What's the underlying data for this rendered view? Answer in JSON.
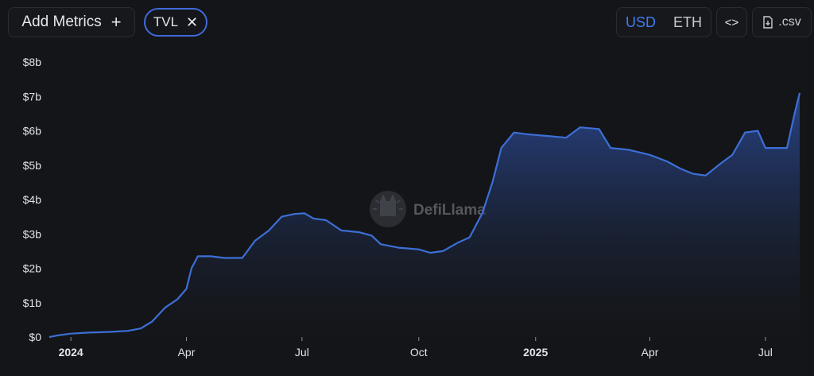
{
  "toolbar": {
    "add_metrics_label": "Add Metrics",
    "add_metrics_icon": "plus-icon",
    "metric_chip_label": "TVL",
    "metric_chip_icon": "close-icon",
    "currency_options": [
      "USD",
      "ETH"
    ],
    "currency_selected": "USD",
    "embed_icon": "code-icon",
    "csv_label": ".csv",
    "csv_icon": "download-file-icon"
  },
  "watermark": {
    "label": "DefiLlama",
    "icon": "llama-logo-icon"
  },
  "colors": {
    "line": "#3c6fd6",
    "area_top": "#2b4a96",
    "area_bottom": "#16181d",
    "background": "#141518",
    "accent": "#3f7cf2"
  },
  "chart_data": {
    "type": "area",
    "title": "",
    "xlabel": "",
    "ylabel": "",
    "ylim": [
      0,
      8
    ],
    "y_ticks": [
      {
        "value": 0,
        "label": "$0"
      },
      {
        "value": 1,
        "label": "$1b"
      },
      {
        "value": 2,
        "label": "$2b"
      },
      {
        "value": 3,
        "label": "$3b"
      },
      {
        "value": 4,
        "label": "$4b"
      },
      {
        "value": 5,
        "label": "$5b"
      },
      {
        "value": 6,
        "label": "$6b"
      },
      {
        "value": 7,
        "label": "$7b"
      },
      {
        "value": 8,
        "label": "$8b"
      }
    ],
    "xlim": [
      "2023-12-15",
      "2025-07-28"
    ],
    "x_ticks": [
      {
        "date": "2024-01-01",
        "label": "2024",
        "bold": true
      },
      {
        "date": "2024-04-01",
        "label": "Apr",
        "bold": false
      },
      {
        "date": "2024-07-01",
        "label": "Jul",
        "bold": false
      },
      {
        "date": "2024-10-01",
        "label": "Oct",
        "bold": false
      },
      {
        "date": "2025-01-01",
        "label": "2025",
        "bold": true
      },
      {
        "date": "2025-04-01",
        "label": "Apr",
        "bold": false
      },
      {
        "date": "2025-07-01",
        "label": "Jul",
        "bold": false
      }
    ],
    "grid": false,
    "series": [
      {
        "unit": "$b",
        "points": [
          [
            "2023-12-15",
            0.0
          ],
          [
            "2023-12-22",
            0.05
          ],
          [
            "2024-01-01",
            0.1
          ],
          [
            "2024-01-15",
            0.13
          ],
          [
            "2024-02-01",
            0.15
          ],
          [
            "2024-02-15",
            0.18
          ],
          [
            "2024-02-25",
            0.25
          ],
          [
            "2024-03-05",
            0.45
          ],
          [
            "2024-03-15",
            0.85
          ],
          [
            "2024-03-25",
            1.1
          ],
          [
            "2024-04-01",
            1.4
          ],
          [
            "2024-04-05",
            2.0
          ],
          [
            "2024-04-10",
            2.35
          ],
          [
            "2024-04-20",
            2.35
          ],
          [
            "2024-05-01",
            2.3
          ],
          [
            "2024-05-15",
            2.3
          ],
          [
            "2024-05-25",
            2.8
          ],
          [
            "2024-06-05",
            3.1
          ],
          [
            "2024-06-15",
            3.5
          ],
          [
            "2024-06-25",
            3.58
          ],
          [
            "2024-07-03",
            3.6
          ],
          [
            "2024-07-10",
            3.45
          ],
          [
            "2024-07-20",
            3.4
          ],
          [
            "2024-08-01",
            3.1
          ],
          [
            "2024-08-15",
            3.05
          ],
          [
            "2024-08-25",
            2.95
          ],
          [
            "2024-09-01",
            2.7
          ],
          [
            "2024-09-15",
            2.6
          ],
          [
            "2024-10-01",
            2.55
          ],
          [
            "2024-10-10",
            2.45
          ],
          [
            "2024-10-20",
            2.5
          ],
          [
            "2024-11-01",
            2.75
          ],
          [
            "2024-11-10",
            2.9
          ],
          [
            "2024-11-20",
            3.6
          ],
          [
            "2024-11-28",
            4.5
          ],
          [
            "2024-12-05",
            5.5
          ],
          [
            "2024-12-15",
            5.95
          ],
          [
            "2024-12-25",
            5.9
          ],
          [
            "2025-01-10",
            5.85
          ],
          [
            "2025-01-25",
            5.8
          ],
          [
            "2025-02-05",
            6.1
          ],
          [
            "2025-02-20",
            6.05
          ],
          [
            "2025-03-01",
            5.5
          ],
          [
            "2025-03-15",
            5.45
          ],
          [
            "2025-04-01",
            5.3
          ],
          [
            "2025-04-15",
            5.1
          ],
          [
            "2025-04-25",
            4.9
          ],
          [
            "2025-05-05",
            4.75
          ],
          [
            "2025-05-15",
            4.7
          ],
          [
            "2025-05-25",
            5.0
          ],
          [
            "2025-06-05",
            5.3
          ],
          [
            "2025-06-15",
            5.95
          ],
          [
            "2025-06-25",
            6.0
          ],
          [
            "2025-07-01",
            5.5
          ],
          [
            "2025-07-10",
            5.5
          ],
          [
            "2025-07-18",
            5.5
          ],
          [
            "2025-07-24",
            6.5
          ],
          [
            "2025-07-28",
            7.1
          ]
        ]
      }
    ]
  }
}
